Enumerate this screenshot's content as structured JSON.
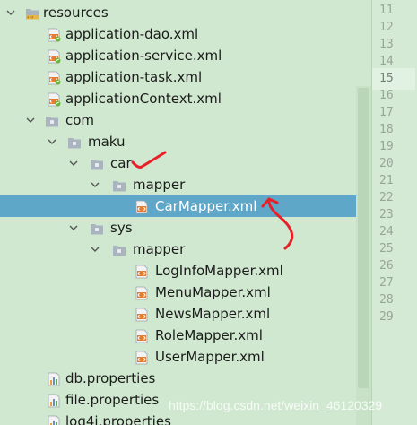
{
  "tree": {
    "resources": "resources",
    "app_dao": "application-dao.xml",
    "app_service": "application-service.xml",
    "app_task": "application-task.xml",
    "app_context": "applicationContext.xml",
    "com": "com",
    "maku": "maku",
    "car": "car",
    "car_mapper": "mapper",
    "car_mapper_xml": "CarMapper.xml",
    "sys": "sys",
    "sys_mapper": "mapper",
    "loginfo_xml": "LogInfoMapper.xml",
    "menu_xml": "MenuMapper.xml",
    "news_xml": "NewsMapper.xml",
    "role_xml": "RoleMapper.xml",
    "user_xml": "UserMapper.xml",
    "db_props": "db.properties",
    "file_props": "file.properties",
    "log4j_props": "log4j.properties"
  },
  "gutter": {
    "lines": [
      "11",
      "12",
      "13",
      "14",
      "15",
      "16",
      "17",
      "18",
      "19",
      "20",
      "21",
      "22",
      "23",
      "24",
      "25",
      "26",
      "27",
      "28",
      "29"
    ],
    "active_line": "15"
  },
  "watermark": "https://blog.csdn.net/weixin_46120329",
  "colors": {
    "background": "#cfe8cf",
    "selection": "#5fa7c8",
    "annotation": "#e8202a"
  }
}
